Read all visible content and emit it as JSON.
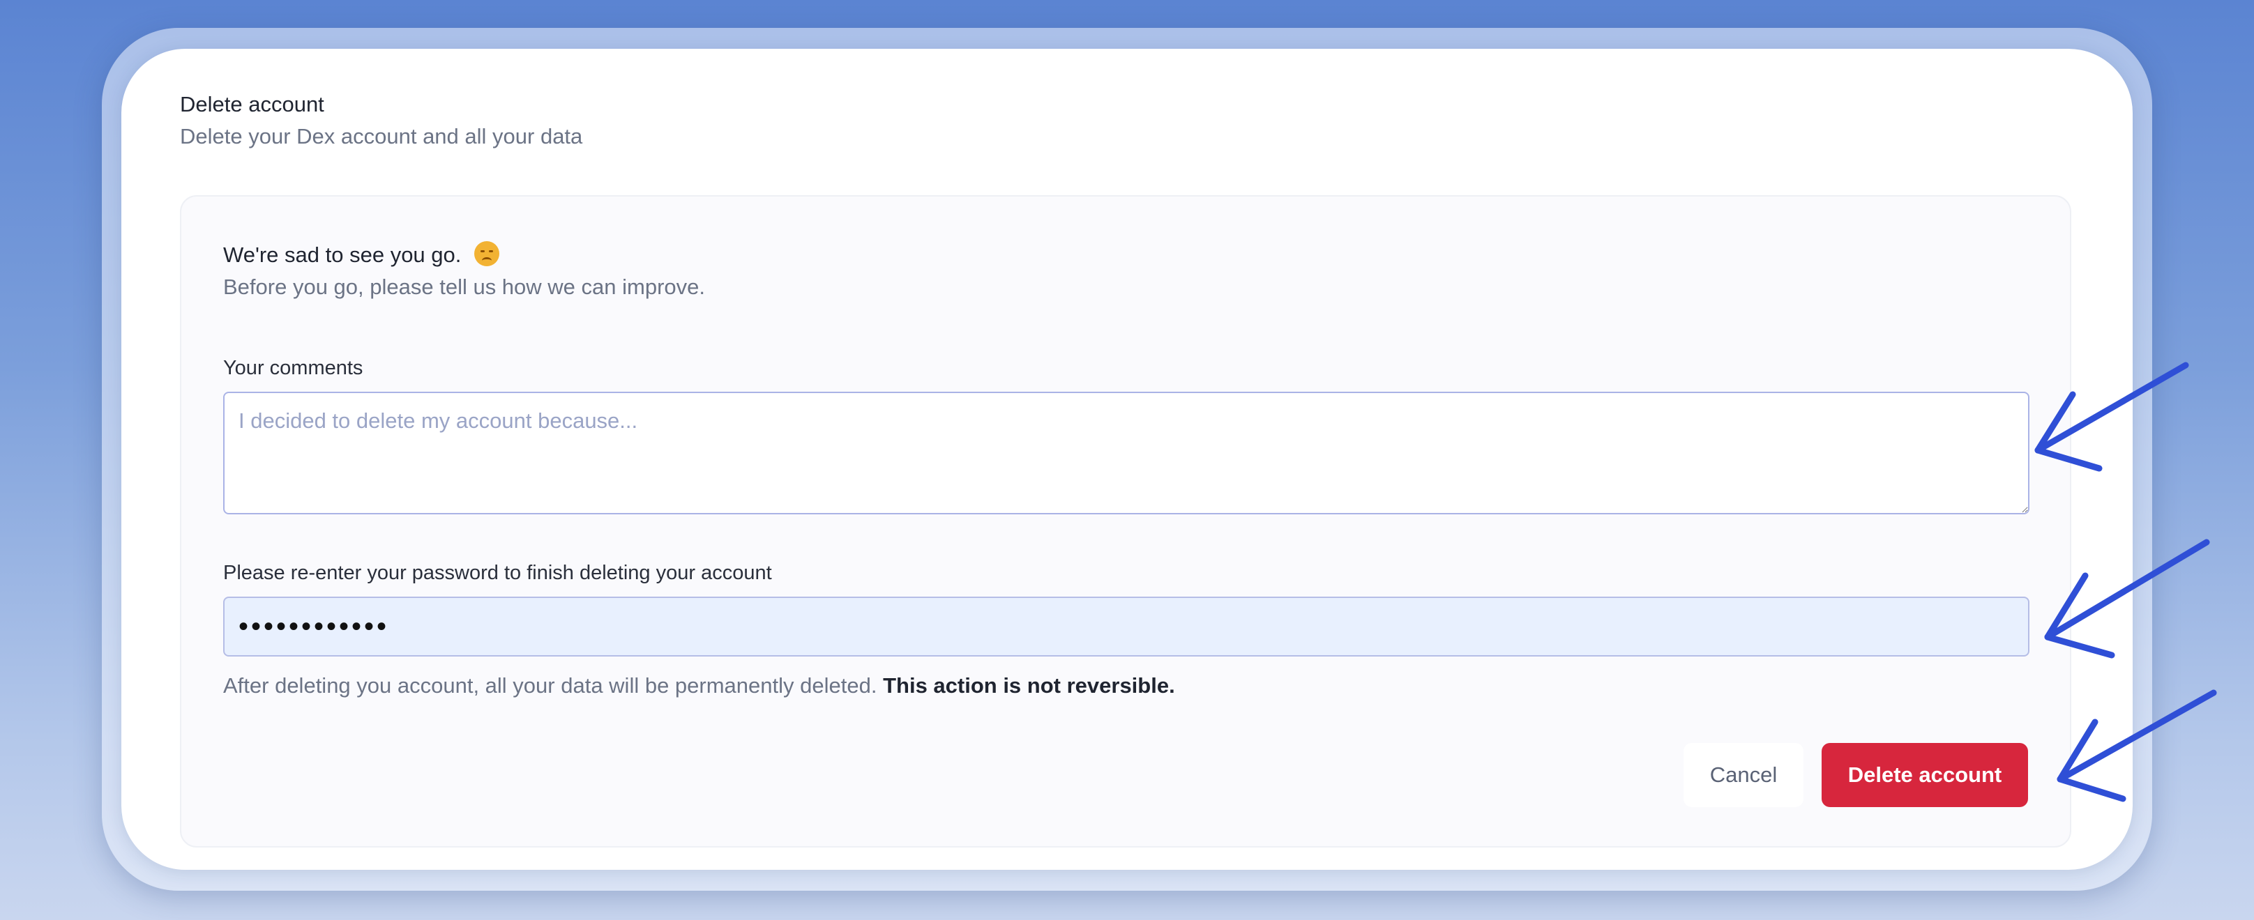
{
  "section": {
    "title": "Delete account",
    "subtitle": "Delete your Dex account and all your data"
  },
  "panel": {
    "heading": "We're sad to see you go.",
    "heading_emoji": "disappointed-face-icon",
    "subheading": "Before you go, please tell us how we can improve."
  },
  "form": {
    "comments_label": "Your comments",
    "comments_placeholder": "I decided to delete my account because...",
    "comments_value": "",
    "password_label": "Please re-enter your password to finish deleting your account",
    "password_value": "aaaaaaaaaaaa",
    "warning_text": "After deleting you account, all your data will be permanently deleted.",
    "warning_strong": "This action is not reversible."
  },
  "buttons": {
    "cancel_label": "Cancel",
    "delete_label": "Delete account"
  },
  "colors": {
    "background": "#5b84d2",
    "danger": "#d7263d",
    "annotation_arrow": "#2f4fd6",
    "password_fill": "#e8f0fe"
  }
}
